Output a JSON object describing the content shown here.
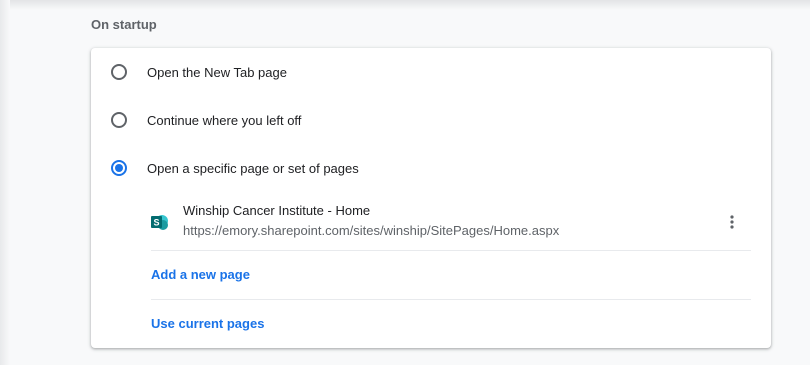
{
  "section": {
    "title": "On startup"
  },
  "options": [
    {
      "label": "Open the New Tab page",
      "selected": false
    },
    {
      "label": "Continue where you left off",
      "selected": false
    },
    {
      "label": "Open a specific page or set of pages",
      "selected": true
    }
  ],
  "pages": [
    {
      "icon": "sharepoint-icon",
      "title": "Winship Cancer Institute - Home",
      "url": "https://emory.sharepoint.com/sites/winship/SitePages/Home.aspx"
    }
  ],
  "actions": {
    "add_new_page": "Add a new page",
    "use_current_pages": "Use current pages"
  },
  "colors": {
    "accent": "#1a73e8",
    "sharepoint": "#0078d4",
    "text": "#202124",
    "secondary_text": "#5f6368"
  }
}
